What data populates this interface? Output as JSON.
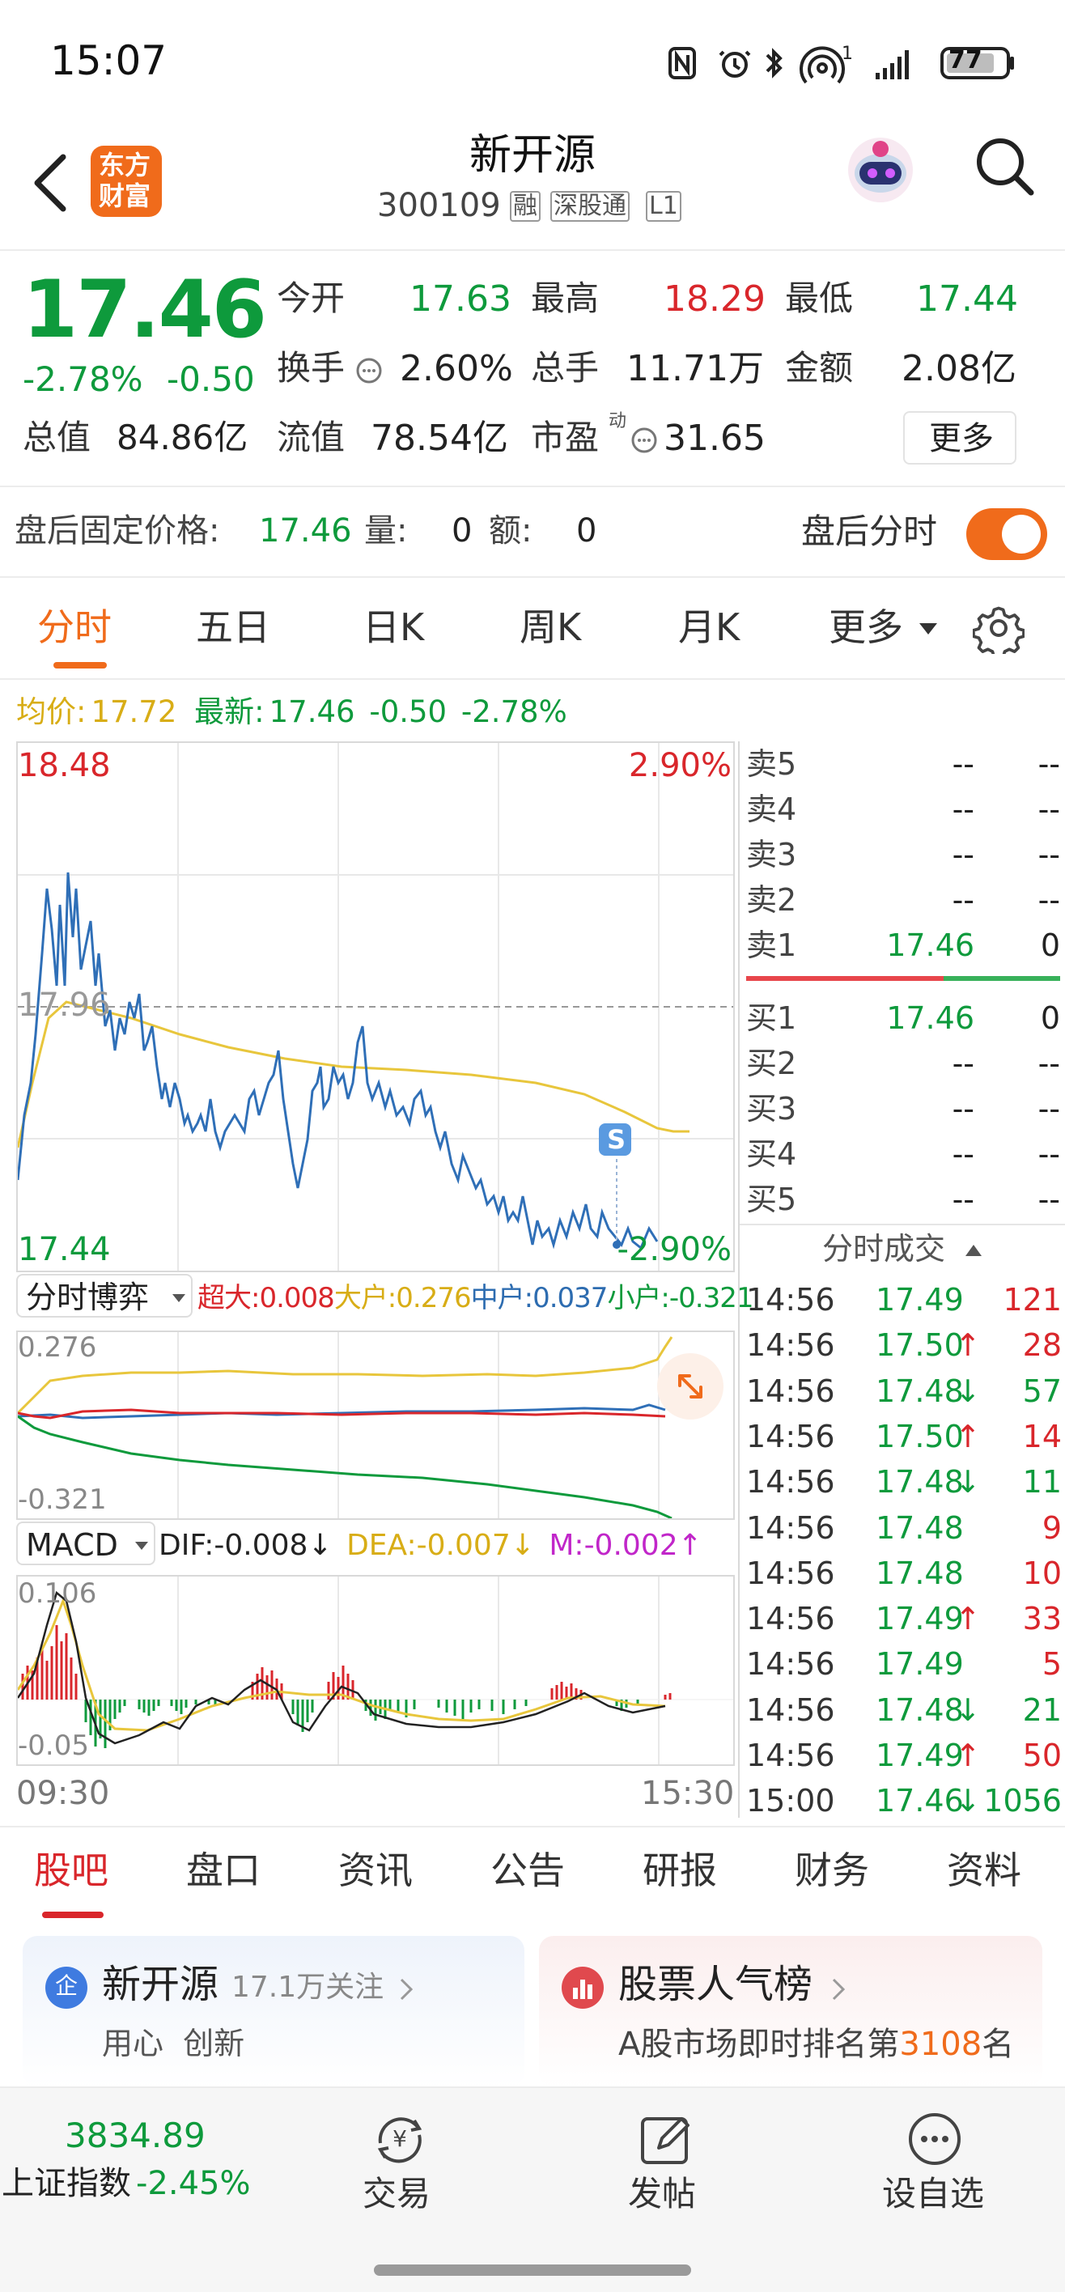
{
  "status_bar": {
    "time": "15:07",
    "battery": "77",
    "signal_sup": "1"
  },
  "header": {
    "app_logo_text_top": "东方",
    "app_logo_text_bottom": "财富",
    "title": "新开源",
    "code": "300109",
    "badges": [
      "融",
      "深股通",
      "L1"
    ]
  },
  "quote": {
    "price": "17.46",
    "change_pct": "-2.78%",
    "change": "-0.50",
    "open_label": "今开",
    "open": "17.63",
    "high_label": "最高",
    "high": "18.29",
    "low_label": "最低",
    "low": "17.44",
    "turnover_label": "换手",
    "turnover": "2.60%",
    "volume_label": "总手",
    "volume": "11.71万",
    "amount_label": "金额",
    "amount": "2.08亿",
    "mktcap_label": "总值",
    "mktcap": "84.86亿",
    "float_label": "流值",
    "float": "78.54亿",
    "pe_label": "市盈",
    "pe_sup": "动",
    "pe": "31.65",
    "more_button": "更多"
  },
  "after_hours": {
    "price_label": "盘后固定价格:",
    "price": "17.46",
    "volume_label": "量:",
    "volume": "0",
    "amount_label": "额:",
    "amount": "0",
    "toggle_label": "盘后分时",
    "toggle_on": true
  },
  "chart_tabs": [
    "分时",
    "五日",
    "日K",
    "周K",
    "月K",
    "更多"
  ],
  "active_chart_tab": "分时",
  "summary_line": {
    "avg_label": "均价:",
    "avg": "17.72",
    "latest_label": "最新:",
    "latest": "17.46",
    "latest_change": "-0.50",
    "latest_pct": "-2.78%"
  },
  "main_chart": {
    "top_price": "18.48",
    "top_pct": "2.90%",
    "mid_price": "17.96",
    "bottom_price": "17.44",
    "bottom_pct": "-2.90%",
    "marker_label": "S"
  },
  "flow_indicator": {
    "selector": "分时博弈",
    "super_label": "超大:",
    "super": "0.008",
    "large_label": "大户:",
    "large": "0.276",
    "mid_label": "中户:",
    "mid": "0.037",
    "small_label": "小户:",
    "small": "-0.321",
    "top_value": "0.276",
    "bottom_value": "-0.321"
  },
  "macd": {
    "selector": "MACD",
    "dif_label": "DIF:",
    "dif": "-0.008",
    "dif_arrow": "↓",
    "dea_label": "DEA:",
    "dea": "-0.007",
    "dea_arrow": "↓",
    "m_label": "M:",
    "m": "-0.002",
    "m_arrow": "↑",
    "top_value": "0.106",
    "bottom_value": "-0.05",
    "time_start": "09:30",
    "time_end": "15:30"
  },
  "order_book": {
    "sells": [
      {
        "label": "卖5",
        "price": "--",
        "vol": "--"
      },
      {
        "label": "卖4",
        "price": "--",
        "vol": "--"
      },
      {
        "label": "卖3",
        "price": "--",
        "vol": "--"
      },
      {
        "label": "卖2",
        "price": "--",
        "vol": "--"
      },
      {
        "label": "卖1",
        "price": "17.46",
        "vol": "0"
      }
    ],
    "buys": [
      {
        "label": "买1",
        "price": "17.46",
        "vol": "0"
      },
      {
        "label": "买2",
        "price": "--",
        "vol": "--"
      },
      {
        "label": "买3",
        "price": "--",
        "vol": "--"
      },
      {
        "label": "买4",
        "price": "--",
        "vol": "--"
      },
      {
        "label": "买5",
        "price": "--",
        "vol": "--"
      }
    ]
  },
  "trades": {
    "title": "分时成交",
    "rows": [
      {
        "time": "14:56",
        "price": "17.49",
        "arrow": "",
        "vol": "121",
        "color": "red"
      },
      {
        "time": "14:56",
        "price": "17.50",
        "arrow": "↑",
        "vol": "28",
        "color": "red"
      },
      {
        "time": "14:56",
        "price": "17.48",
        "arrow": "↓",
        "vol": "57",
        "color": "grn"
      },
      {
        "time": "14:56",
        "price": "17.50",
        "arrow": "↑",
        "vol": "14",
        "color": "red"
      },
      {
        "time": "14:56",
        "price": "17.48",
        "arrow": "↓",
        "vol": "11",
        "color": "grn"
      },
      {
        "time": "14:56",
        "price": "17.48",
        "arrow": "",
        "vol": "9",
        "color": "red"
      },
      {
        "time": "14:56",
        "price": "17.48",
        "arrow": "",
        "vol": "10",
        "color": "red"
      },
      {
        "time": "14:56",
        "price": "17.49",
        "arrow": "↑",
        "vol": "33",
        "color": "red"
      },
      {
        "time": "14:56",
        "price": "17.49",
        "arrow": "",
        "vol": "5",
        "color": "red"
      },
      {
        "time": "14:56",
        "price": "17.48",
        "arrow": "↓",
        "vol": "21",
        "color": "grn"
      },
      {
        "time": "14:56",
        "price": "17.49",
        "arrow": "↑",
        "vol": "50",
        "color": "red"
      },
      {
        "time": "15:00",
        "price": "17.46",
        "arrow": "↓",
        "vol": "1056",
        "color": "grn"
      }
    ]
  },
  "bottom_tabs": [
    "股吧",
    "盘口",
    "资讯",
    "公告",
    "研报",
    "财务",
    "资料"
  ],
  "active_bottom_tab": "股吧",
  "cards": {
    "left": {
      "icon": "企",
      "title": "新开源",
      "followers": "17.1万关注",
      "tags": "用心  创新"
    },
    "right": {
      "title": "股票人气榜",
      "text_pre": "A股市场即时排名第",
      "rank": "3108",
      "text_post": "名"
    }
  },
  "footer": {
    "index_value": "3834.89",
    "index_name": "上证指数",
    "index_change": "-2.45%",
    "trade_label": "交易",
    "post_label": "发帖",
    "watchlist_label": "设自选"
  },
  "colors": {
    "up": "#d9262b",
    "down": "#0e9a3c",
    "accent": "#f06b1b",
    "avg_line": "#e8c63c",
    "price_line": "#2f6fb7"
  }
}
